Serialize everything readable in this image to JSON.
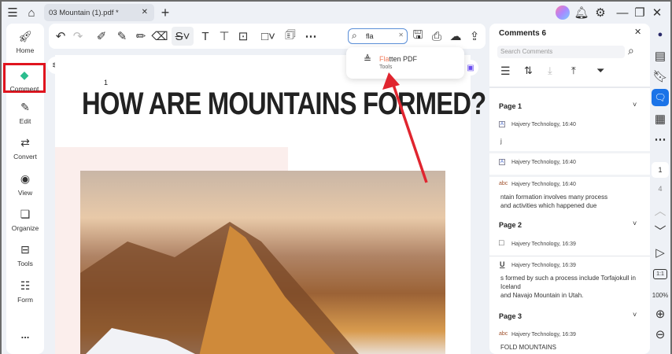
{
  "titlebar": {
    "tab_title": "03 Mountain (1).pdf *"
  },
  "sidebar": {
    "items": [
      {
        "label": "Home"
      },
      {
        "label": "Comment"
      },
      {
        "label": "Edit"
      },
      {
        "label": "Convert"
      },
      {
        "label": "View"
      },
      {
        "label": "Organize"
      },
      {
        "label": "Tools"
      },
      {
        "label": "Form"
      }
    ],
    "more": "..."
  },
  "search": {
    "value": "fla"
  },
  "dropdown": {
    "match": "Fla",
    "rest": "tten PDF",
    "category": "Tools"
  },
  "document": {
    "page_number": "1",
    "heading": "HOW ARE MOUNTAINS FORMED?"
  },
  "comments": {
    "title": "Comments 6",
    "search_placeholder": "Search Comments",
    "groups": [
      {
        "page": "Page 1",
        "items": [
          {
            "type": "A",
            "author": "Hajvery Technology,",
            "time": "16:40",
            "text": "j"
          },
          {
            "type": "A",
            "author": "Hajvery Technology,",
            "time": "16:40",
            "text": ""
          },
          {
            "type": "abc",
            "author": "Hajvery Technology,",
            "time": "16:40",
            "text": "ntain formation involves many process",
            "text2": "and activities which happened due"
          }
        ]
      },
      {
        "page": "Page 2",
        "items": [
          {
            "type": "□",
            "author": "Hajvery Technology,",
            "time": "16:39"
          },
          {
            "type": "U",
            "author": "Hajvery Technology,",
            "time": "16:39",
            "text": "s formed by such a process include Torfajokull in",
            "text2": "Iceland",
            "text3": "and Navajo Mountain in Utah."
          }
        ]
      },
      {
        "page": "Page 3",
        "items": [
          {
            "type": "abc",
            "author": "Hajvery Technology,",
            "time": "16:39",
            "text": "FOLD MOUNTAINS"
          }
        ]
      }
    ]
  },
  "rail": {
    "page_current": "1",
    "page_total": "4",
    "zoom": "100%",
    "fit": "1:1"
  },
  "colors": {
    "accent": "#1a73e8",
    "highlight_box": "#e0141e",
    "arrow": "#e0252f",
    "match": "#f07b5a"
  }
}
